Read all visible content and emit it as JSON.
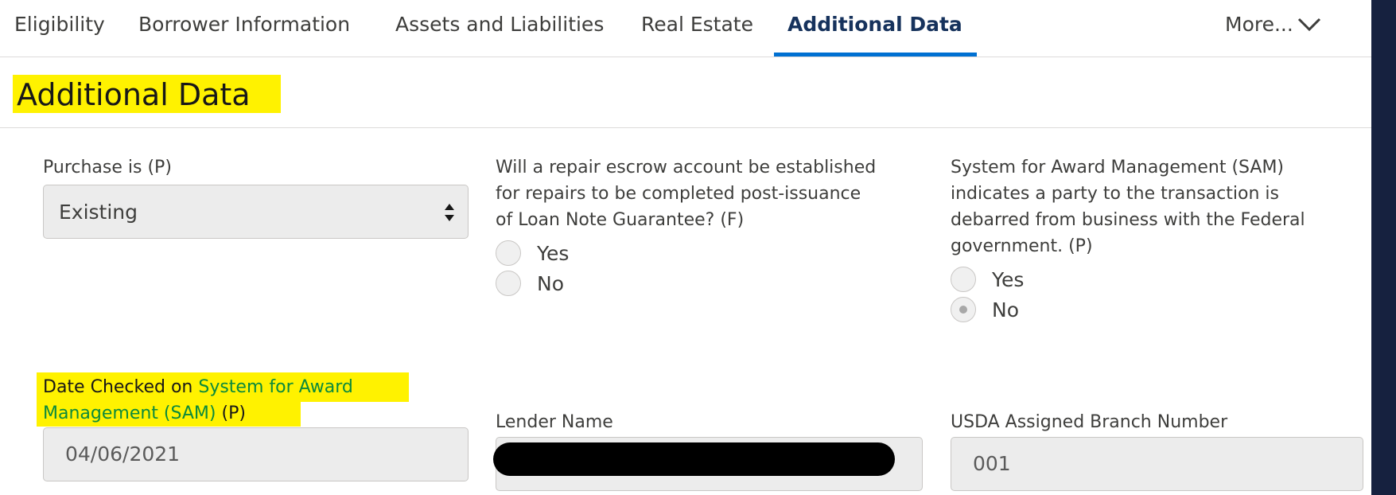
{
  "tabs": [
    "Eligibility",
    "Borrower Information",
    "Assets and Liabilities",
    "Real Estate",
    "Additional Data"
  ],
  "more_label": "More...",
  "page_title": "Additional Data",
  "purchase": {
    "label": "Purchase is (P)",
    "value": "Existing"
  },
  "repair_escrow": {
    "label_lines": [
      "Will a repair escrow account be established",
      "for repairs to be completed post-issuance",
      "of Loan Note Guarantee? (F)"
    ],
    "options": [
      "Yes",
      "No"
    ],
    "selected": null
  },
  "sam": {
    "label_lines": [
      "System for Award Management (SAM)",
      "indicates a party to the transaction is",
      "debarred from business with the Federal",
      "government. (P)"
    ],
    "options": [
      "Yes",
      "No"
    ],
    "selected": "No"
  },
  "date_checked": {
    "label_prefix": "Date Checked on ",
    "label_link1": "System for Award",
    "label_link2": "Management (SAM)",
    "label_suffix": " (P)",
    "value": "04/06/2021"
  },
  "lender": {
    "label": "Lender Name",
    "value": ""
  },
  "branch": {
    "label": "USDA Assigned Branch Number",
    "value": "001"
  },
  "colors": {
    "highlight": "#fff200",
    "accent": "#0070d2",
    "link_green": "#0b8a3c"
  }
}
